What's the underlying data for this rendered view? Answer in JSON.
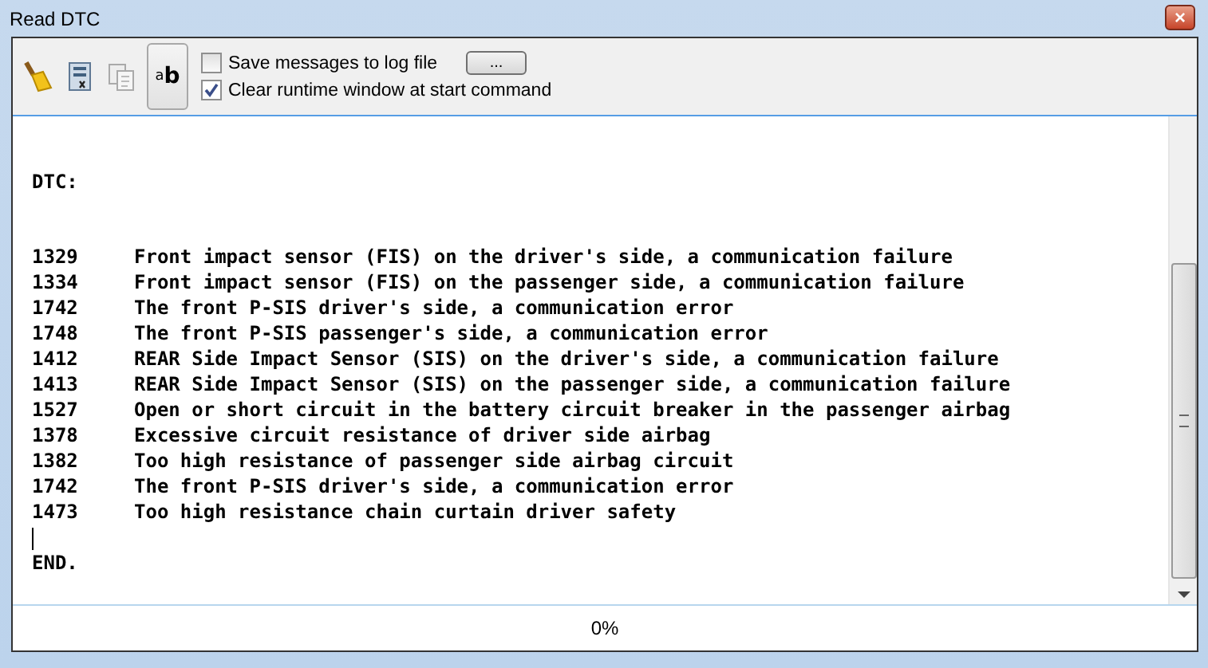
{
  "window": {
    "title": "Read DTC",
    "close": "×"
  },
  "toolbar": {
    "tools": [
      {
        "kind": "broom"
      },
      {
        "kind": "sheet"
      },
      {
        "kind": "copy"
      },
      {
        "kind": "toggle",
        "label": "$^{a}$b",
        "selected": true
      }
    ],
    "options": [
      {
        "label": "Save messages to log file",
        "checked": false
      },
      {
        "label": "Clear runtime window at start command",
        "checked": true
      }
    ],
    "browse": "..."
  },
  "output": {
    "heading": "DTC:",
    "codes": [
      {
        "code": "1329",
        "text": "Front impact sensor (FIS) on the driver's side, a communication failure"
      },
      {
        "code": "1334",
        "text": "Front impact sensor (FIS) on the passenger side, a communication failure"
      },
      {
        "code": "1742",
        "text": "The front P-SIS driver's side, a communication error"
      },
      {
        "code": "1748",
        "text": "The front P-SIS passenger's side, a communication error"
      },
      {
        "code": "1412",
        "text": "REAR Side Impact Sensor (SIS) on the driver's side, a communication failure"
      },
      {
        "code": "1413",
        "text": "REAR Side Impact Sensor (SIS) on the passenger side, a communication failure"
      },
      {
        "code": "1527",
        "text": "Open or short circuit in the battery circuit breaker in the passenger airbag"
      },
      {
        "code": "1378",
        "text": "Excessive circuit resistance of driver side airbag"
      },
      {
        "code": "1382",
        "text": "Too high resistance of passenger side airbag circuit"
      },
      {
        "code": "1742",
        "text": "The front P-SIS driver's side, a communication error"
      },
      {
        "code": "1473",
        "text": "Too high resistance chain curtain driver safety"
      }
    ],
    "footer": "END."
  },
  "status_bar": {
    "progress": "0%"
  }
}
